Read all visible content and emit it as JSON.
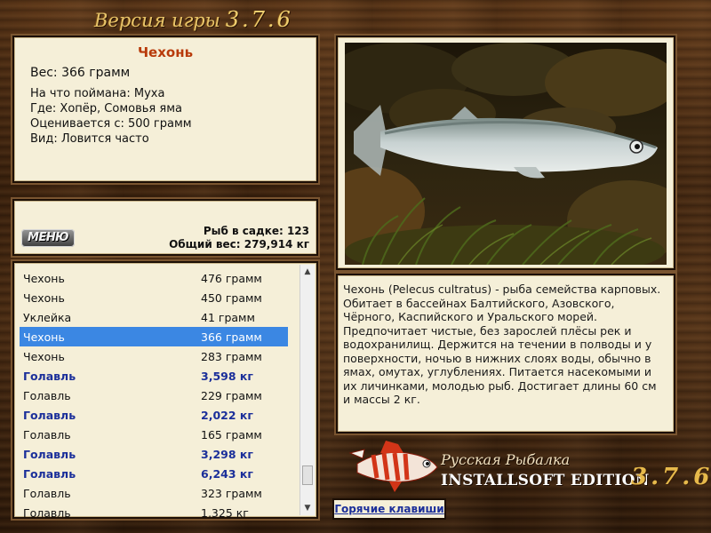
{
  "header": {
    "title": "Версия игры",
    "version": "3.7.6"
  },
  "fish_info": {
    "name": "Чехонь",
    "weight": "Вес: 366 грамм",
    "lines": [
      "На что поймана: Муха",
      "Где: Хопёр, Сомовья яма",
      "Оценивается с: 500 грамм",
      "Вид: Ловится часто"
    ]
  },
  "summary": {
    "menu_label": "МЕНЮ",
    "fish_count": "Рыб в садке: 123",
    "total_weight": "Общий вес: 279,914 кг"
  },
  "catch_list": {
    "rows": [
      {
        "name": "Чехонь",
        "weight": "476 грамм",
        "bold": false,
        "selected": false
      },
      {
        "name": "Чехонь",
        "weight": "450 грамм",
        "bold": false,
        "selected": false
      },
      {
        "name": "Уклейка",
        "weight": "41 грамм",
        "bold": false,
        "selected": false
      },
      {
        "name": "Чехонь",
        "weight": "366 грамм",
        "bold": false,
        "selected": true
      },
      {
        "name": "Чехонь",
        "weight": "283 грамм",
        "bold": false,
        "selected": false
      },
      {
        "name": "Голавль",
        "weight": "3,598 кг",
        "bold": true,
        "selected": false
      },
      {
        "name": "Голавль",
        "weight": "229 грамм",
        "bold": false,
        "selected": false
      },
      {
        "name": "Голавль",
        "weight": "2,022 кг",
        "bold": true,
        "selected": false
      },
      {
        "name": "Голавль",
        "weight": "165 грамм",
        "bold": false,
        "selected": false
      },
      {
        "name": "Голавль",
        "weight": "3,298 кг",
        "bold": true,
        "selected": false
      },
      {
        "name": "Голавль",
        "weight": "6,243 кг",
        "bold": true,
        "selected": false
      },
      {
        "name": "Голавль",
        "weight": "323 грамм",
        "bold": false,
        "selected": false
      },
      {
        "name": "Голавль",
        "weight": "1,325 кг",
        "bold": false,
        "selected": false
      }
    ],
    "scroll_up": "▲",
    "scroll_down": "▼"
  },
  "description": "Чехонь (Pelecus cultratus) - рыба семейства карповых. Обитает в бассейнах Балтийского, Азовского, Чёрного, Каспийского и Уральского морей. Предпочитает чистые, без зарослей плёсы рек и водохранилищ. Держится на течении в полводы и у поверхности, ночью в нижних слоях воды, обычно в ямах, омутах, углублениях. Питается насекомыми и их личинками, молодью рыб. Достигает длины 60 см и массы 2 кг.",
  "logo": {
    "line1": "Русская Рыбалка",
    "line2": "INSTALLSOFT EDITION",
    "version": "3.7.6"
  },
  "hotkeys_label": "Горячие клавиши",
  "colors": {
    "title_red": "#b83a0a",
    "bold_blue": "#1b2f9a",
    "selection": "#3b87e3",
    "panel_bg": "#f5efd8"
  }
}
